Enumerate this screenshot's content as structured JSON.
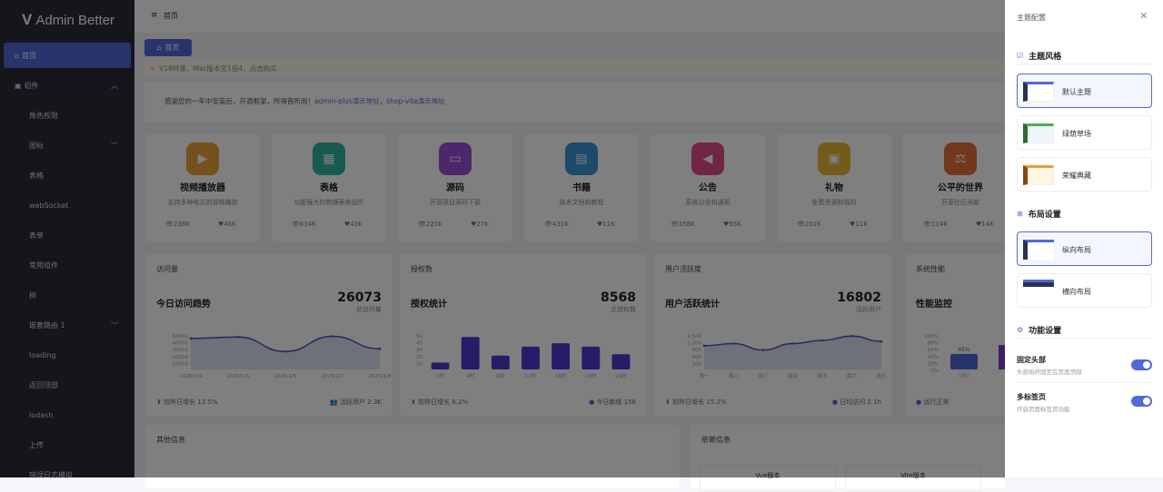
{
  "app": {
    "title": "Admin Better"
  },
  "sidebar": {
    "items": [
      {
        "label": "首页",
        "icon": "home-icon",
        "active": true
      },
      {
        "label": "组件",
        "icon": "component-icon",
        "expanded": true
      },
      {
        "label": "角色权限"
      },
      {
        "label": "图标",
        "chevron": "down"
      },
      {
        "label": "表格"
      },
      {
        "label": "webSocket"
      },
      {
        "label": "表单"
      },
      {
        "label": "常用组件"
      },
      {
        "label": "树"
      },
      {
        "label": "嵌套路由 1",
        "chevron": "down"
      },
      {
        "label": "loading"
      },
      {
        "label": "返回顶部"
      },
      {
        "label": "lodash"
      },
      {
        "label": "上传"
      },
      {
        "label": "错误日志模拟"
      }
    ]
  },
  "header": {
    "breadcrumb": "首页",
    "tab": "首页"
  },
  "notice": {
    "text": "V18特惠，Mac版本至1倍4，点击购买"
  },
  "intro": {
    "text": "感谢您的一年中安装后，开源框架，所得首所用！",
    "link1": "admin-plus演示地址",
    "sep": "，",
    "link2": "shop-vite演示地址"
  },
  "cards": [
    {
      "title": "视频播放器",
      "desc": "支持多种格式的视频播放",
      "views": "238K",
      "likes": "46K",
      "color": "#e8a23a",
      "icon": "▶"
    },
    {
      "title": "表格",
      "desc": "功能强大的数据表格组件",
      "views": "634K",
      "likes": "43K",
      "color": "#2fb5a4",
      "icon": "▦"
    },
    {
      "title": "源码",
      "desc": "开源项目源码下载",
      "views": "225K",
      "likes": "27K",
      "color": "#9b4fd6",
      "icon": "▭"
    },
    {
      "title": "书籍",
      "desc": "技术文档和教程",
      "views": "431K",
      "likes": "11K",
      "color": "#3a93d6",
      "icon": "▤"
    },
    {
      "title": "公告",
      "desc": "系统公告和通知",
      "views": "358K",
      "likes": "95K",
      "color": "#e14a8a",
      "icon": "◀"
    },
    {
      "title": "礼物",
      "desc": "免费资源和福利",
      "views": "202K",
      "likes": "11K",
      "color": "#e9b637",
      "icon": "▣"
    },
    {
      "title": "公平的世界",
      "desc": "开源社区贡献",
      "views": "114K",
      "likes": "14K",
      "color": "#e2713a",
      "icon": "⚖"
    }
  ],
  "charts": {
    "visits": {
      "label": "访问量",
      "subtitle": "今日访问趋势",
      "number": "26073",
      "number_label": "总访问量",
      "foot_left": "较昨日增长 12.5%",
      "foot_right": "活跃用户 2.3K"
    },
    "auth": {
      "label": "授权数",
      "subtitle": "授权统计",
      "number": "8568",
      "number_label": "总授权数",
      "foot_left": "较昨日增长 8.2%",
      "foot_right": "今日新增 156"
    },
    "active": {
      "label": "用户活跃度",
      "subtitle": "用户活跃统计",
      "number": "16802",
      "number_label": "活跃用户",
      "foot_left": "较昨日增长 15.2%",
      "foot_right": "日均访问 2.1h"
    },
    "perf": {
      "label": "系统性能",
      "subtitle": "性能监控",
      "foot_left": "运行正常"
    }
  },
  "chart_data": [
    {
      "type": "area",
      "name": "visits",
      "categories": [
        "2025/1/4",
        "2025/1/5",
        "2025/1/6",
        "2025/1/7",
        "2025/1/8"
      ],
      "values": [
        45000,
        47000,
        26000,
        48000,
        30000
      ],
      "yticks": [
        "50000",
        "40000",
        "30000",
        "20000",
        "10000"
      ],
      "ylim": [
        0,
        50000
      ]
    },
    {
      "type": "bar",
      "name": "auth",
      "categories": [
        "0时",
        "4时",
        "8时",
        "12时",
        "16时",
        "20时",
        "24时"
      ],
      "values": [
        10,
        47,
        20,
        33,
        38,
        33,
        22
      ],
      "yticks": [
        "50",
        "40",
        "30",
        "20",
        "10"
      ],
      "ylim": [
        0,
        50
      ]
    },
    {
      "type": "area",
      "name": "active",
      "categories": [
        "周一",
        "周二",
        "周三",
        "周四",
        "周五",
        "周六",
        "周日"
      ],
      "values": [
        1100,
        1200,
        900,
        1200,
        1350,
        1550,
        1300
      ],
      "yticks": [
        "1,500",
        "1,200",
        "900",
        "600",
        "300"
      ],
      "ylim": [
        0,
        1600
      ]
    },
    {
      "type": "bar",
      "name": "perf",
      "categories": [
        "CPU"
      ],
      "values": [
        45
      ],
      "value_labels": [
        "45%"
      ],
      "yticks": [
        "100%",
        "80%",
        "60%",
        "40%",
        "20%",
        "0%"
      ],
      "ylim": [
        0,
        100
      ]
    }
  ],
  "bottom": {
    "other": "其他信息",
    "deps": "依赖信息",
    "dep1": "Vue版本",
    "dep2": "Vite版本"
  },
  "drawer": {
    "title": "主题配置",
    "theme_section": "主题风格",
    "themes": [
      "默认主题",
      "绿荫草场",
      "荣耀典藏"
    ],
    "layout_section": "布局设置",
    "layouts": [
      "纵向布局",
      "横向布局"
    ],
    "feature_section": "功能设置",
    "fixed_header": {
      "label": "固定头部",
      "desc": "头部始终固定在页面顶部",
      "on": true
    },
    "multi_tab": {
      "label": "多标签页",
      "desc": "开启页面标签页功能",
      "on": true
    }
  },
  "colors": {
    "accent": "#5068d8",
    "sidebar": "#2a2c38"
  }
}
